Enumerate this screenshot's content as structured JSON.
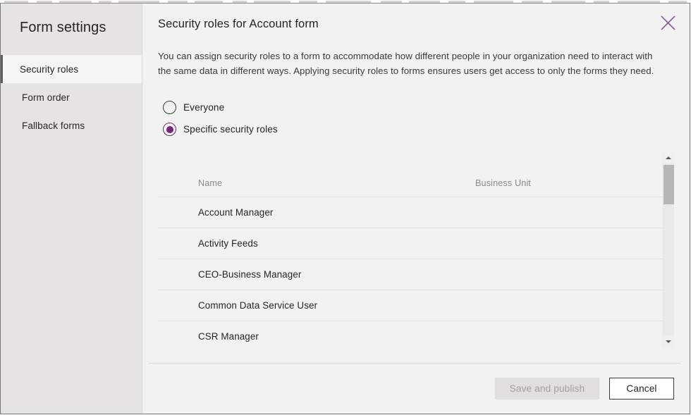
{
  "window": {
    "background_color": "#f2f2f2",
    "border_color": "#7a7a7a"
  },
  "sidebar": {
    "title": "Form settings",
    "background_color": "#e6e4e3",
    "selected_index": 0,
    "items": [
      {
        "label": "Security roles",
        "selected": true
      },
      {
        "label": "Form order",
        "selected": false
      },
      {
        "label": "Fallback forms",
        "selected": false
      }
    ]
  },
  "header": {
    "title": "Security roles for Account form",
    "close_icon": "close-icon",
    "close_icon_color": "#8e5ba6"
  },
  "main": {
    "description": "You can assign security roles to a form to accommodate how different people in your organization need to interact with the same data in different ways. Applying security roles to forms ensures users get access to only the forms they need.",
    "radio_options": [
      {
        "label": "Everyone",
        "checked": false
      },
      {
        "label": "Specific security roles",
        "checked": true
      }
    ],
    "accent_color": "#742774"
  },
  "table": {
    "columns": [
      "Name",
      "Business Unit"
    ],
    "rows": [
      {
        "name": "Account Manager",
        "business_unit": ""
      },
      {
        "name": "Activity Feeds",
        "business_unit": ""
      },
      {
        "name": "CEO-Business Manager",
        "business_unit": ""
      },
      {
        "name": "Common Data Service User",
        "business_unit": ""
      },
      {
        "name": "CSR Manager",
        "business_unit": ""
      }
    ],
    "scrollbar": {
      "up_icon": "chevron-up-icon",
      "down_icon": "chevron-down-icon",
      "thumb_color": "#b6b6b6",
      "track_color": "#e9e9e9"
    }
  },
  "footer": {
    "save_label": "Save and publish",
    "save_disabled": true,
    "cancel_label": "Cancel"
  }
}
